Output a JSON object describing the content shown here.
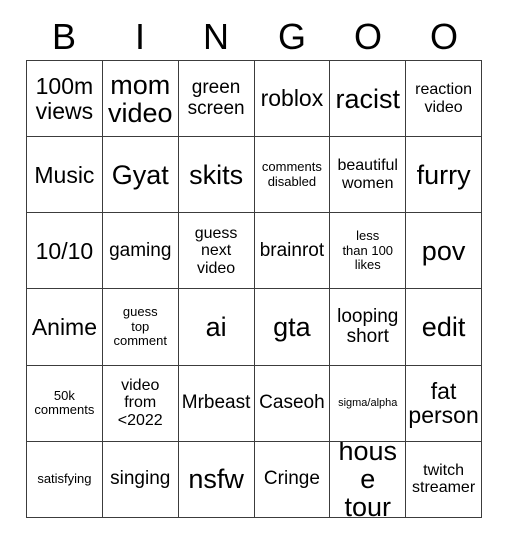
{
  "card": {
    "header_letters": [
      "B",
      "I",
      "N",
      "G",
      "O",
      "O"
    ],
    "columns": 6,
    "rows": 6,
    "colors": {
      "background": "#ffffff",
      "text": "#000000",
      "grid_line": "#3c3c3c"
    },
    "cells": [
      [
        {
          "text": "100m\nviews",
          "size": "xl"
        },
        {
          "text": "mom\nvideo",
          "size": "xxl"
        },
        {
          "text": "green\nscreen",
          "size": "l"
        },
        {
          "text": "roblox",
          "size": "xl"
        },
        {
          "text": "racist",
          "size": "xxl"
        },
        {
          "text": "reaction\nvideo",
          "size": "m"
        }
      ],
      [
        {
          "text": "Music",
          "size": "xl"
        },
        {
          "text": "Gyat",
          "size": "xxl"
        },
        {
          "text": "skits",
          "size": "xxl"
        },
        {
          "text": "comments\ndisabled",
          "size": "s"
        },
        {
          "text": "beautiful\nwomen",
          "size": "m"
        },
        {
          "text": "furry",
          "size": "xxl"
        }
      ],
      [
        {
          "text": "10/10",
          "size": "xl"
        },
        {
          "text": "gaming",
          "size": "l"
        },
        {
          "text": "guess\nnext\nvideo",
          "size": "m"
        },
        {
          "text": "brainrot",
          "size": "l"
        },
        {
          "text": "less\nthan 100\nlikes",
          "size": "s"
        },
        {
          "text": "pov",
          "size": "xxl"
        }
      ],
      [
        {
          "text": "Anime",
          "size": "xl"
        },
        {
          "text": "guess\ntop\ncomment",
          "size": "s"
        },
        {
          "text": "ai",
          "size": "xxl"
        },
        {
          "text": "gta",
          "size": "xxl"
        },
        {
          "text": "looping\nshort",
          "size": "l"
        },
        {
          "text": "edit",
          "size": "xxl"
        }
      ],
      [
        {
          "text": "50k\ncomments",
          "size": "s"
        },
        {
          "text": "video\nfrom\n<2022",
          "size": "m"
        },
        {
          "text": "Mrbeast",
          "size": "l"
        },
        {
          "text": "Caseoh",
          "size": "l"
        },
        {
          "text": "sigma/alpha",
          "size": "xs"
        },
        {
          "text": "fat\nperson",
          "size": "xl"
        }
      ],
      [
        {
          "text": "satisfying",
          "size": "s"
        },
        {
          "text": "singing",
          "size": "l"
        },
        {
          "text": "nsfw",
          "size": "xxl"
        },
        {
          "text": "Cringe",
          "size": "l"
        },
        {
          "text": "house\ntour",
          "size": "xxl"
        },
        {
          "text": "twitch\nstreamer",
          "size": "m"
        }
      ]
    ]
  }
}
